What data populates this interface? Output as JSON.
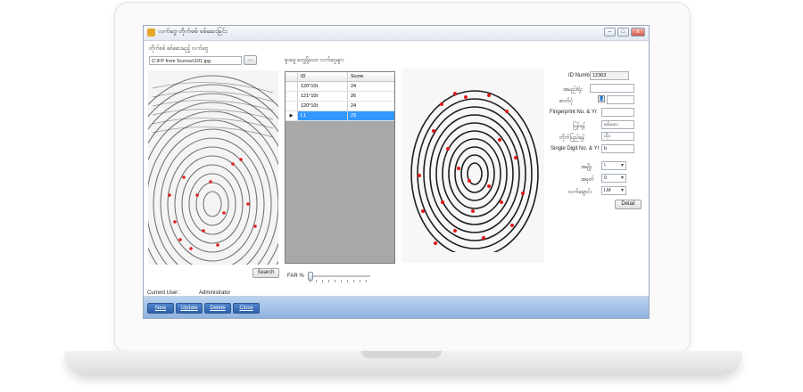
{
  "window": {
    "title": "လက်ဗွေ တိုက်စစ် စစ်ဆေးခြင်း",
    "minimize_glyph": "–",
    "maximize_glyph": "□",
    "close_glyph": "x"
  },
  "input_section": {
    "label": "တိုက်စစ် စစ်ဆေးမည့် လက်ဗွေ",
    "file_path": "C:\\FP from Scence\\101.jpg",
    "browse_label": "..."
  },
  "results": {
    "title": "ရှာဖွေ တွေ့ရှိသော လက်ဗွေများ",
    "columns": [
      "ID",
      "Score"
    ],
    "rows": [
      {
        "id": "120°10t",
        "score": "24",
        "selected": false
      },
      {
        "id": "121°10t",
        "score": "26",
        "selected": false
      },
      {
        "id": "120°10t",
        "score": "24",
        "selected": false
      },
      {
        "id": "L1",
        "score": "29",
        "selected": true
      }
    ]
  },
  "search_button": "Search",
  "far_label": "FAR %",
  "far_value": 0.0,
  "details": {
    "id_number_label": "ID Number",
    "id_number_value": "12363",
    "name_label": "အမည်/ရုံး",
    "name_value": "",
    "photo_label": "ဓာတ်ပုံ",
    "fingerprint_no_label": "Fingerprint No. & Yr",
    "fingerprint_no_value": "",
    "classification_label": "ပြန်ရန်",
    "classification_value": "စစ်ဆေး",
    "sub_class_label": "တိုက်ပြည်ရန်",
    "sub_class_value": "ထိုး",
    "single_digit_label": "Single Digit No. & Yr",
    "single_digit_value": "b",
    "finger_label": "အမျိုး",
    "finger_value": "\\",
    "hand_label": "အမှတ်",
    "hand_value": "0",
    "position_label": "လက်ချောင်း",
    "position_value": "LM",
    "detail_button": "Detail"
  },
  "current_user_label": "Current User :",
  "current_user_value": "Administrator",
  "actions": [
    "New",
    "Update",
    "Delete",
    "Close"
  ]
}
